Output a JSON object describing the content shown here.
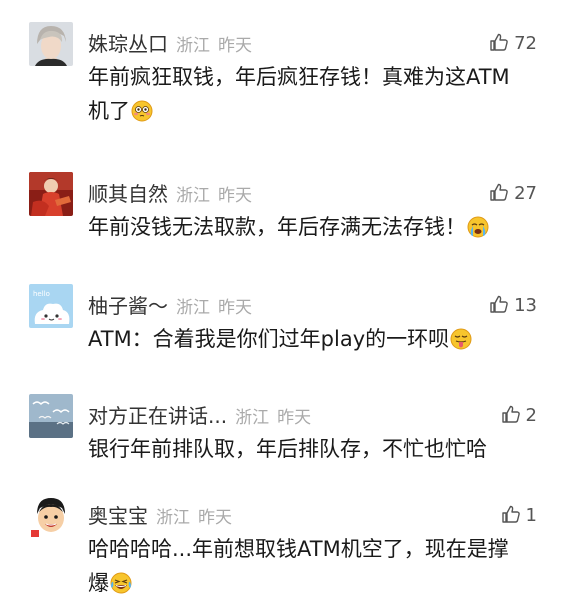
{
  "comments": [
    {
      "username": "姝琮丛口",
      "location": "浙江",
      "time": "昨天",
      "likes": "72",
      "text_lines": [
        "年前疯狂取钱，年后疯狂存钱！真难为这ATM",
        "机了"
      ],
      "emoji": "flushed-face-emoji",
      "avatar": "man-portrait-avatar"
    },
    {
      "username": "顺其自然",
      "location": "浙江",
      "time": "昨天",
      "likes": "27",
      "text_lines": [
        "年前没钱无法取款，年后存满无法存钱！"
      ],
      "emoji": "crying-face-emoji",
      "avatar": "red-costume-avatar"
    },
    {
      "username": "柚子酱～",
      "location": "浙江",
      "time": "昨天",
      "likes": "13",
      "text_lines": [
        "ATM：合着我是你们过年play的一环呗"
      ],
      "emoji": "tongue-face-emoji",
      "avatar": "cartoon-cloud-avatar"
    },
    {
      "username": "对方正在讲话...",
      "location": "浙江",
      "time": "昨天",
      "likes": "2",
      "text_lines": [
        "银行年前排队取，年后排队存，不忙也忙哈"
      ],
      "emoji": "",
      "avatar": "seagulls-sky-avatar"
    },
    {
      "username": "奥宝宝",
      "location": "浙江",
      "time": "昨天",
      "likes": "1",
      "text_lines": [
        "哈哈哈哈...年前想取钱ATM机空了，现在是撑",
        "爆"
      ],
      "emoji": "laughing-tears-emoji",
      "avatar": "cartoon-kid-avatar"
    }
  ],
  "colors": {
    "username": "#333333",
    "meta": "#aaaaaa",
    "text": "#1a1a1a",
    "like": "#555555"
  }
}
